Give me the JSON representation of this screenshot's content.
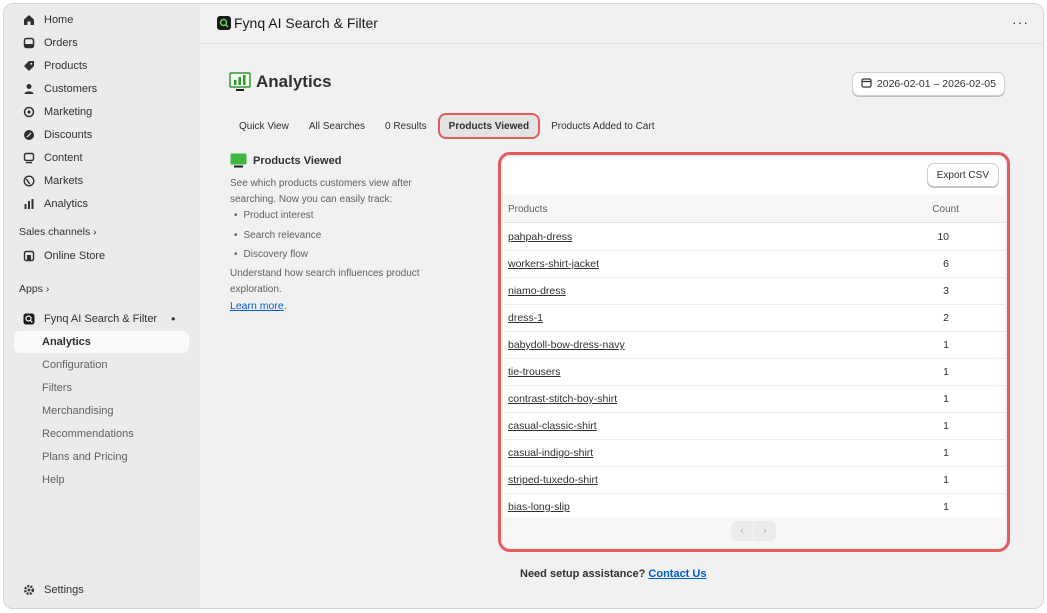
{
  "sidebar": {
    "items": [
      {
        "label": "Home",
        "icon": "home-icon"
      },
      {
        "label": "Orders",
        "icon": "orders-icon"
      },
      {
        "label": "Products",
        "icon": "tag-icon"
      },
      {
        "label": "Customers",
        "icon": "person-icon"
      },
      {
        "label": "Marketing",
        "icon": "target-icon"
      },
      {
        "label": "Discounts",
        "icon": "discount-icon"
      },
      {
        "label": "Content",
        "icon": "content-icon"
      },
      {
        "label": "Markets",
        "icon": "globe-icon"
      },
      {
        "label": "Analytics",
        "icon": "bar-chart-icon"
      }
    ],
    "sales_channels": "Sales channels ›",
    "online_store": "Online Store",
    "apps": "Apps ›",
    "app_name": "Fynq AI Search & Filter",
    "app_dot": "•",
    "sub_items": [
      "Analytics",
      "Configuration",
      "Filters",
      "Merchandising",
      "Recommendations",
      "Plans and Pricing",
      "Help"
    ],
    "settings": "Settings"
  },
  "header": {
    "app_title": "Fynq AI Search & Filter",
    "more": "···"
  },
  "page": {
    "title": "Analytics",
    "date_range": "2026-02-01 – 2026-02-05"
  },
  "tabs": [
    "Quick View",
    "All Searches",
    "0 Results",
    "Products Viewed",
    "Products Added to Cart"
  ],
  "active_tab": "Products Viewed",
  "info": {
    "title": "Products Viewed",
    "description": "See which products customers view after searching. Now you can easily track:",
    "bullets": [
      "Product interest",
      "Search relevance",
      "Discovery flow"
    ],
    "summary": "Understand how search influences product exploration.",
    "learn_more": "Learn more",
    "learn_suffix": "."
  },
  "table": {
    "export_label": "Export CSV",
    "columns": [
      "Products",
      "Count"
    ],
    "rows": [
      [
        "pahpah-dress",
        "10"
      ],
      [
        "workers-shirt-jacket",
        "6"
      ],
      [
        "niamo-dress",
        "3"
      ],
      [
        "dress-1",
        "2"
      ],
      [
        "babydoll-bow-dress-navy",
        "1"
      ],
      [
        "tie-trousers",
        "1"
      ],
      [
        "contrast-stitch-boy-shirt",
        "1"
      ],
      [
        "casual-classic-shirt",
        "1"
      ],
      [
        "casual-indigo-shirt",
        "1"
      ],
      [
        "striped-tuxedo-shirt",
        "1"
      ],
      [
        "bias-long-slip",
        "1"
      ]
    ],
    "prev": "‹",
    "next": "›"
  },
  "footer": {
    "text": "Need setup assistance?",
    "link": "Contact Us"
  },
  "colors": {
    "highlight": "#e25c5c",
    "link": "#005bd3",
    "brand_green": "#2e9b2e"
  }
}
